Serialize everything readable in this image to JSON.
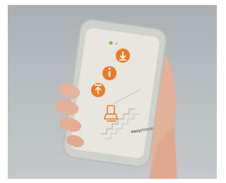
{
  "image": {
    "subject": "handheld-remote-control",
    "brand_part1": "easy",
    "brand_part2": "move",
    "colors": {
      "background": "#b8bdc0",
      "housing": "#c9cbc6",
      "face": "#e6e4dd",
      "button": "#ee7b23",
      "led": "#7dc242",
      "skin": "#e7b9a3"
    },
    "icons": [
      "arrow-down-icon",
      "info-icon",
      "arrow-up-icon",
      "stair-lift-icon"
    ]
  }
}
